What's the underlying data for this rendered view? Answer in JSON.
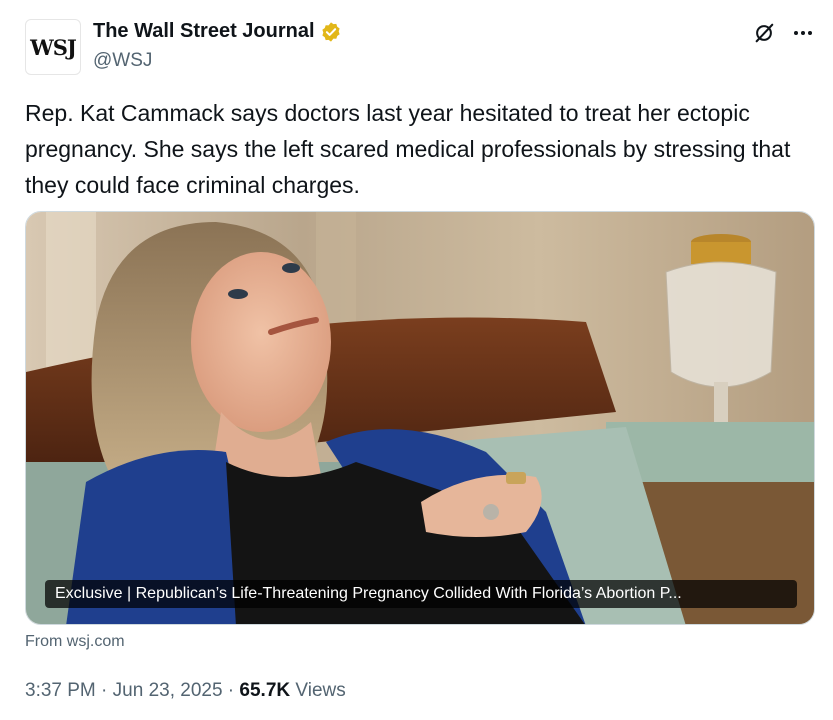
{
  "author": {
    "avatar_text": "WSJ",
    "display_name": "The Wall Street Journal",
    "handle": "@WSJ",
    "verified": true
  },
  "tweet": {
    "text": "Rep. Kat Cammack says doctors last year hesitated to treat her ectopic pregnancy. She says the left scared medical professionals by stressing that they could face criminal charges."
  },
  "card": {
    "headline": "Exclusive | Republican’s Life-Threatening Pregnancy Collided With Florida’s Abortion P...",
    "source": "From wsj.com"
  },
  "meta": {
    "time": "3:37 PM",
    "separator": " · ",
    "date": "Jun 23, 2025",
    "views_count": "65.7K",
    "views_label": " Views"
  },
  "icons": {
    "verified": "verified-badge-icon",
    "grok": "grok-icon",
    "more": "more-options-icon"
  },
  "colors": {
    "text_primary": "#0f1419",
    "text_secondary": "#536471",
    "verified_gold": "#e2b719"
  }
}
